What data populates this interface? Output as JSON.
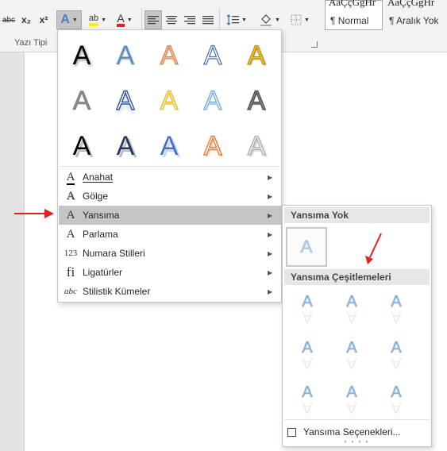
{
  "ribbon": {
    "strikethrough": "abc",
    "subscript": "x₂",
    "superscript": "x²",
    "text_effects": "A",
    "highlight": "ab",
    "font_color": "A",
    "group_label": "Yazı Tipi",
    "styles": [
      {
        "sample": "AaÇçĞğHr",
        "name": "¶ Normal"
      },
      {
        "sample": "AaÇçĞğHr",
        "name": "¶ Aralık Yok"
      }
    ]
  },
  "menu": {
    "grid_glyph": "A",
    "items": [
      {
        "icon": "A",
        "label": "Anahat"
      },
      {
        "icon": "A",
        "label": "Gölge"
      },
      {
        "icon": "A",
        "label": "Yansıma"
      },
      {
        "icon": "A",
        "label": "Parlama"
      },
      {
        "icon": "123",
        "label": "Numara Stilleri"
      },
      {
        "icon": "fi",
        "label": "Ligatürler"
      },
      {
        "icon": "abc",
        "label": "Stilistik Kümeler"
      }
    ],
    "arrow": "▶"
  },
  "submenu": {
    "header_none": "Yansıma Yok",
    "none_glyph": "A",
    "header_variations": "Yansıma Çeşitlemeleri",
    "variation_glyph": "A",
    "options_label": "Yansıma Seçenekleri...",
    "grip": "• • • •"
  },
  "colors": {
    "accent_red": "#e41f1f",
    "hover": "#c5c5c5",
    "reflection_blue": "#9cc1e6"
  }
}
